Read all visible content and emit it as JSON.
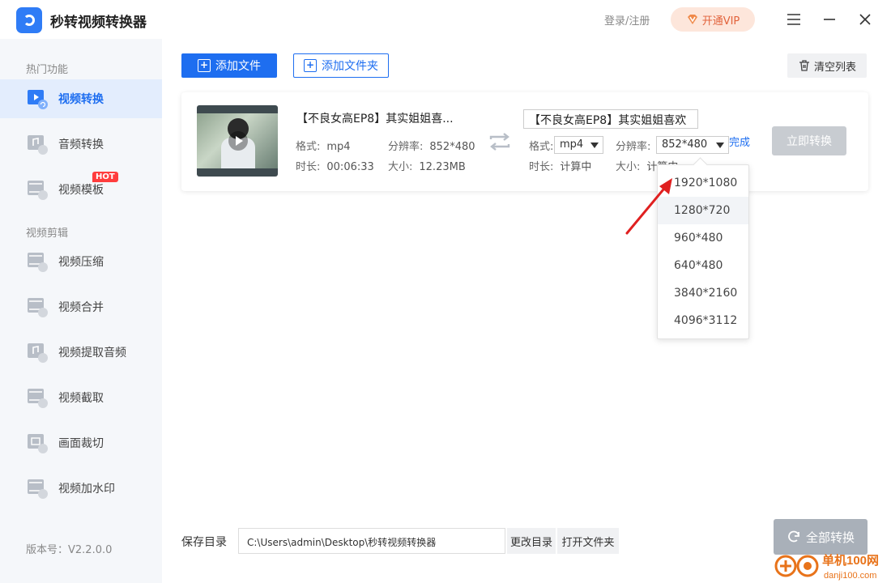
{
  "app": {
    "title": "秒转视频转换器"
  },
  "header": {
    "login_label": "登录/注册",
    "vip_label": "开通VIP",
    "menu_icon": "menu-icon",
    "minimize_icon": "minimize-icon",
    "close_icon": "close-icon"
  },
  "sidebar": {
    "section_hot": "热门功能",
    "section_edit": "视频剪辑",
    "hot_items": [
      {
        "label": "视频转换",
        "icon": "video-convert-icon",
        "active": true
      },
      {
        "label": "音频转换",
        "icon": "audio-convert-icon"
      },
      {
        "label": "视频模板",
        "icon": "video-template-icon",
        "badge": "HOT"
      }
    ],
    "edit_items": [
      {
        "label": "视频压缩",
        "icon": "video-compress-icon"
      },
      {
        "label": "视频合并",
        "icon": "video-merge-icon"
      },
      {
        "label": "视频提取音频",
        "icon": "extract-audio-icon"
      },
      {
        "label": "视频截取",
        "icon": "video-cut-icon"
      },
      {
        "label": "画面裁切",
        "icon": "crop-icon"
      },
      {
        "label": "视频加水印",
        "icon": "watermark-icon"
      }
    ],
    "version": "版本号：V2.2.0.0"
  },
  "toolbar": {
    "add_file": "添加文件",
    "add_folder": "添加文件夹",
    "clear_list": "清空列表"
  },
  "file": {
    "source_name": "【不良女高EP8】其实姐姐喜...",
    "format_label": "格式:",
    "format_value": "mp4",
    "resolution_label": "分辨率:",
    "resolution_value": "852*480",
    "duration_label": "时长:",
    "duration_value": "00:06:33",
    "size_label": "大小:",
    "size_value": "12.23MB",
    "output_name": "【不良女高EP8】其实姐姐喜欢",
    "out_format_label": "格式:",
    "out_format_value": "mp4",
    "out_resolution_label": "分辨率:",
    "out_resolution_value": "852*480",
    "out_duration_label": "时长:",
    "out_duration_value": "计算中",
    "out_size_label": "大小:",
    "out_size_value": "计算中",
    "done_label": "完成",
    "convert_now": "立即转换"
  },
  "resolution_options": [
    "1920*1080",
    "1280*720",
    "960*480",
    "640*480",
    "3840*2160",
    "4096*3112"
  ],
  "bottom": {
    "save_label": "保存目录",
    "save_path": "C:\\Users\\admin\\Desktop\\秒转视频转换器",
    "change_dir": "更改目录",
    "open_folder": "打开文件夹",
    "convert_all": "全部转换"
  },
  "watermark": {
    "site_name": "单机100网",
    "site_url": "danji100.com"
  },
  "colors": {
    "accent": "#1e6ef0",
    "vip_bg": "#fde6db",
    "vip_text": "#e2633c",
    "hot": "#ff3d3d",
    "arrow": "#e02020"
  }
}
